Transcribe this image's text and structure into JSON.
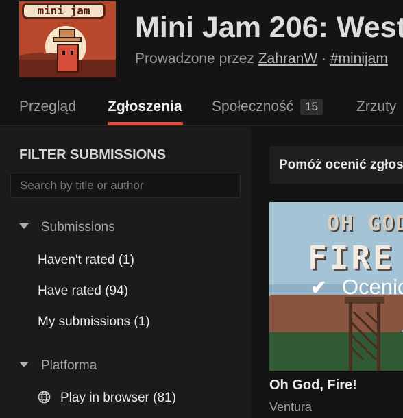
{
  "header": {
    "thumbnail_text": "mini jam",
    "title": "Mini Jam 206: West",
    "byline_prefix": "Prowadzone przez",
    "host": "ZahranW",
    "separator": "·",
    "tag": "#minijam"
  },
  "tabs": {
    "items": [
      {
        "label": "Przegląd"
      },
      {
        "label": "Zgłoszenia"
      },
      {
        "label": "Społeczność",
        "badge": "15"
      },
      {
        "label": "Zrzuty"
      }
    ],
    "active": "Zgłoszenia"
  },
  "sidebar": {
    "title": "FILTER SUBMISSIONS",
    "search_placeholder": "Search by title or author",
    "sections": [
      {
        "label": "Submissions",
        "items": [
          "Haven't rated (1)",
          "Have rated (94)",
          "My submissions (1)"
        ]
      },
      {
        "label": "Platforma",
        "items": [
          "Play in browser (81)"
        ]
      }
    ]
  },
  "main": {
    "help_text": "Pomóż ocenić zgłoszenia",
    "card": {
      "image_text_top": "OH GOD",
      "image_text_big": "FIRE",
      "overlay_check": "✔",
      "overlay_label": "Ocenio",
      "title": "Oh God, Fire!",
      "author": "Ventura"
    }
  },
  "colors": {
    "accent": "#d8503a",
    "background": "#141414",
    "sidebar": "#1b1b1b"
  }
}
